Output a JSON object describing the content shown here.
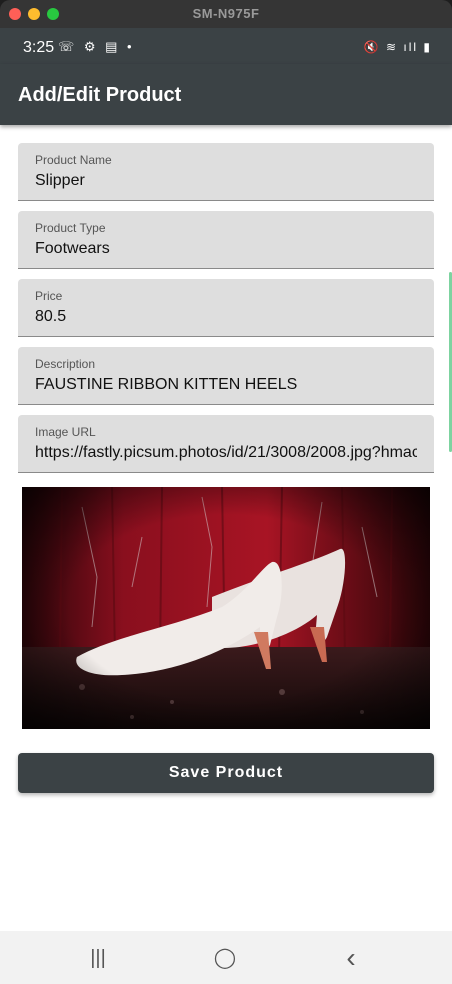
{
  "window": {
    "title": "SM-N975F"
  },
  "status_bar": {
    "time": "3:25",
    "left_icons": "☏ ⚙ ▤ •",
    "right_icons": "🔇 ≋ ıll ▮"
  },
  "app_bar": {
    "title": "Add/Edit Product"
  },
  "form": {
    "product_name": {
      "label": "Product Name",
      "value": "Slipper"
    },
    "product_type": {
      "label": "Product Type",
      "value": "Footwears"
    },
    "price": {
      "label": "Price",
      "value": "80.5"
    },
    "description": {
      "label": "Description",
      "value": "FAUSTINE RIBBON KITTEN HEELS"
    },
    "image_url": {
      "label": "Image URL",
      "value": "https://fastly.picsum.photos/id/21/3008/2008.jpg?hmac=T8DSVNvP-QldCew7WD4jj_S3mWwxZPqdF0CNPksSko4"
    }
  },
  "save_button": {
    "label": "Save Product"
  },
  "nav": {
    "recents": "|||",
    "home": "◯",
    "back": "‹"
  },
  "colors": {
    "primary": "#3b4245",
    "field_bg": "#dedede"
  },
  "icons": [
    "whatsapp-icon",
    "settings-icon",
    "calendar-icon",
    "mute-icon",
    "wifi-icon",
    "signal-icon",
    "battery-icon"
  ]
}
